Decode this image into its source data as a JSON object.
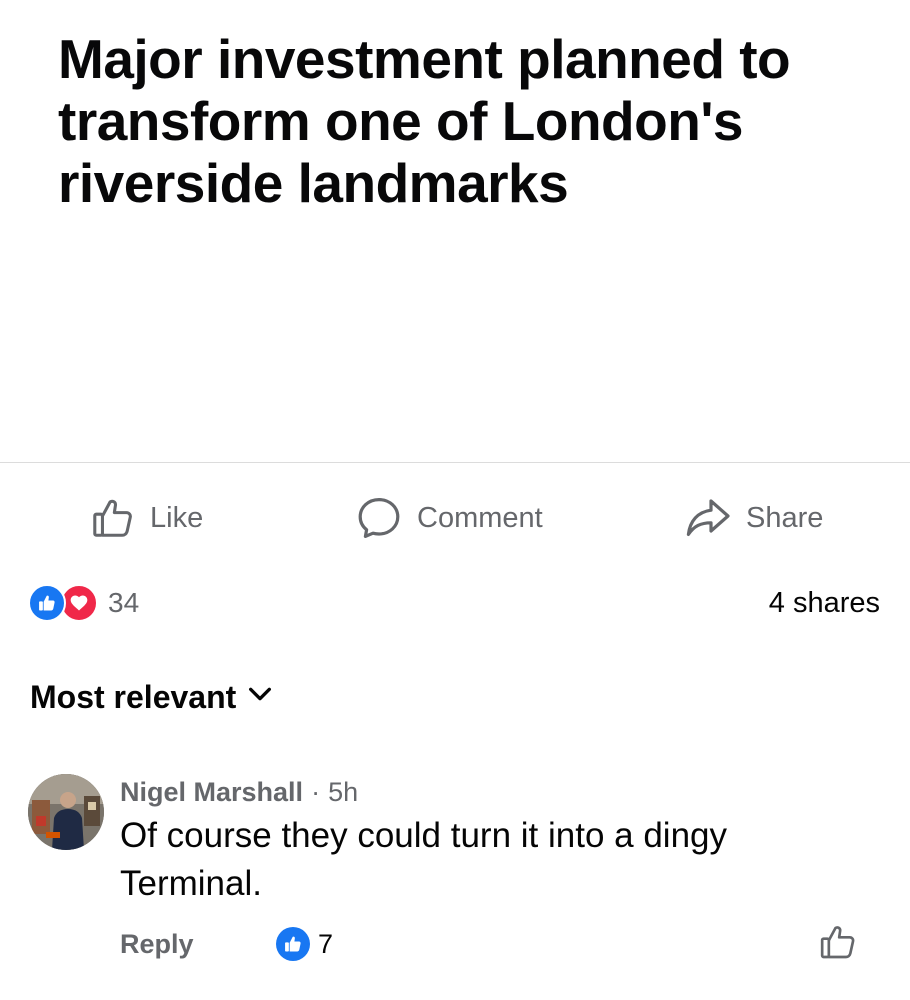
{
  "post": {
    "headline": "Major investment planned to transform one of London's riverside landmarks"
  },
  "actions": {
    "like_label": "Like",
    "comment_label": "Comment",
    "share_label": "Share"
  },
  "reactions": {
    "types": [
      "like",
      "love"
    ],
    "count": "34",
    "shares": "4 shares"
  },
  "comments_sort": {
    "label": "Most relevant"
  },
  "comments": [
    {
      "author": "Nigel Marshall",
      "separator": "·",
      "time": "5h",
      "text": "Of course they could turn it into a dingy Terminal.",
      "reply_label": "Reply",
      "like_count": "7"
    }
  ],
  "colors": {
    "accent_blue": "#1877f2",
    "love_red": "#f02849",
    "secondary_text": "#65676b",
    "primary_text": "#050505"
  },
  "icons": [
    "thumbs-up-icon",
    "comment-bubble-icon",
    "share-arrow-icon",
    "love-heart-icon",
    "chevron-down-icon"
  ]
}
